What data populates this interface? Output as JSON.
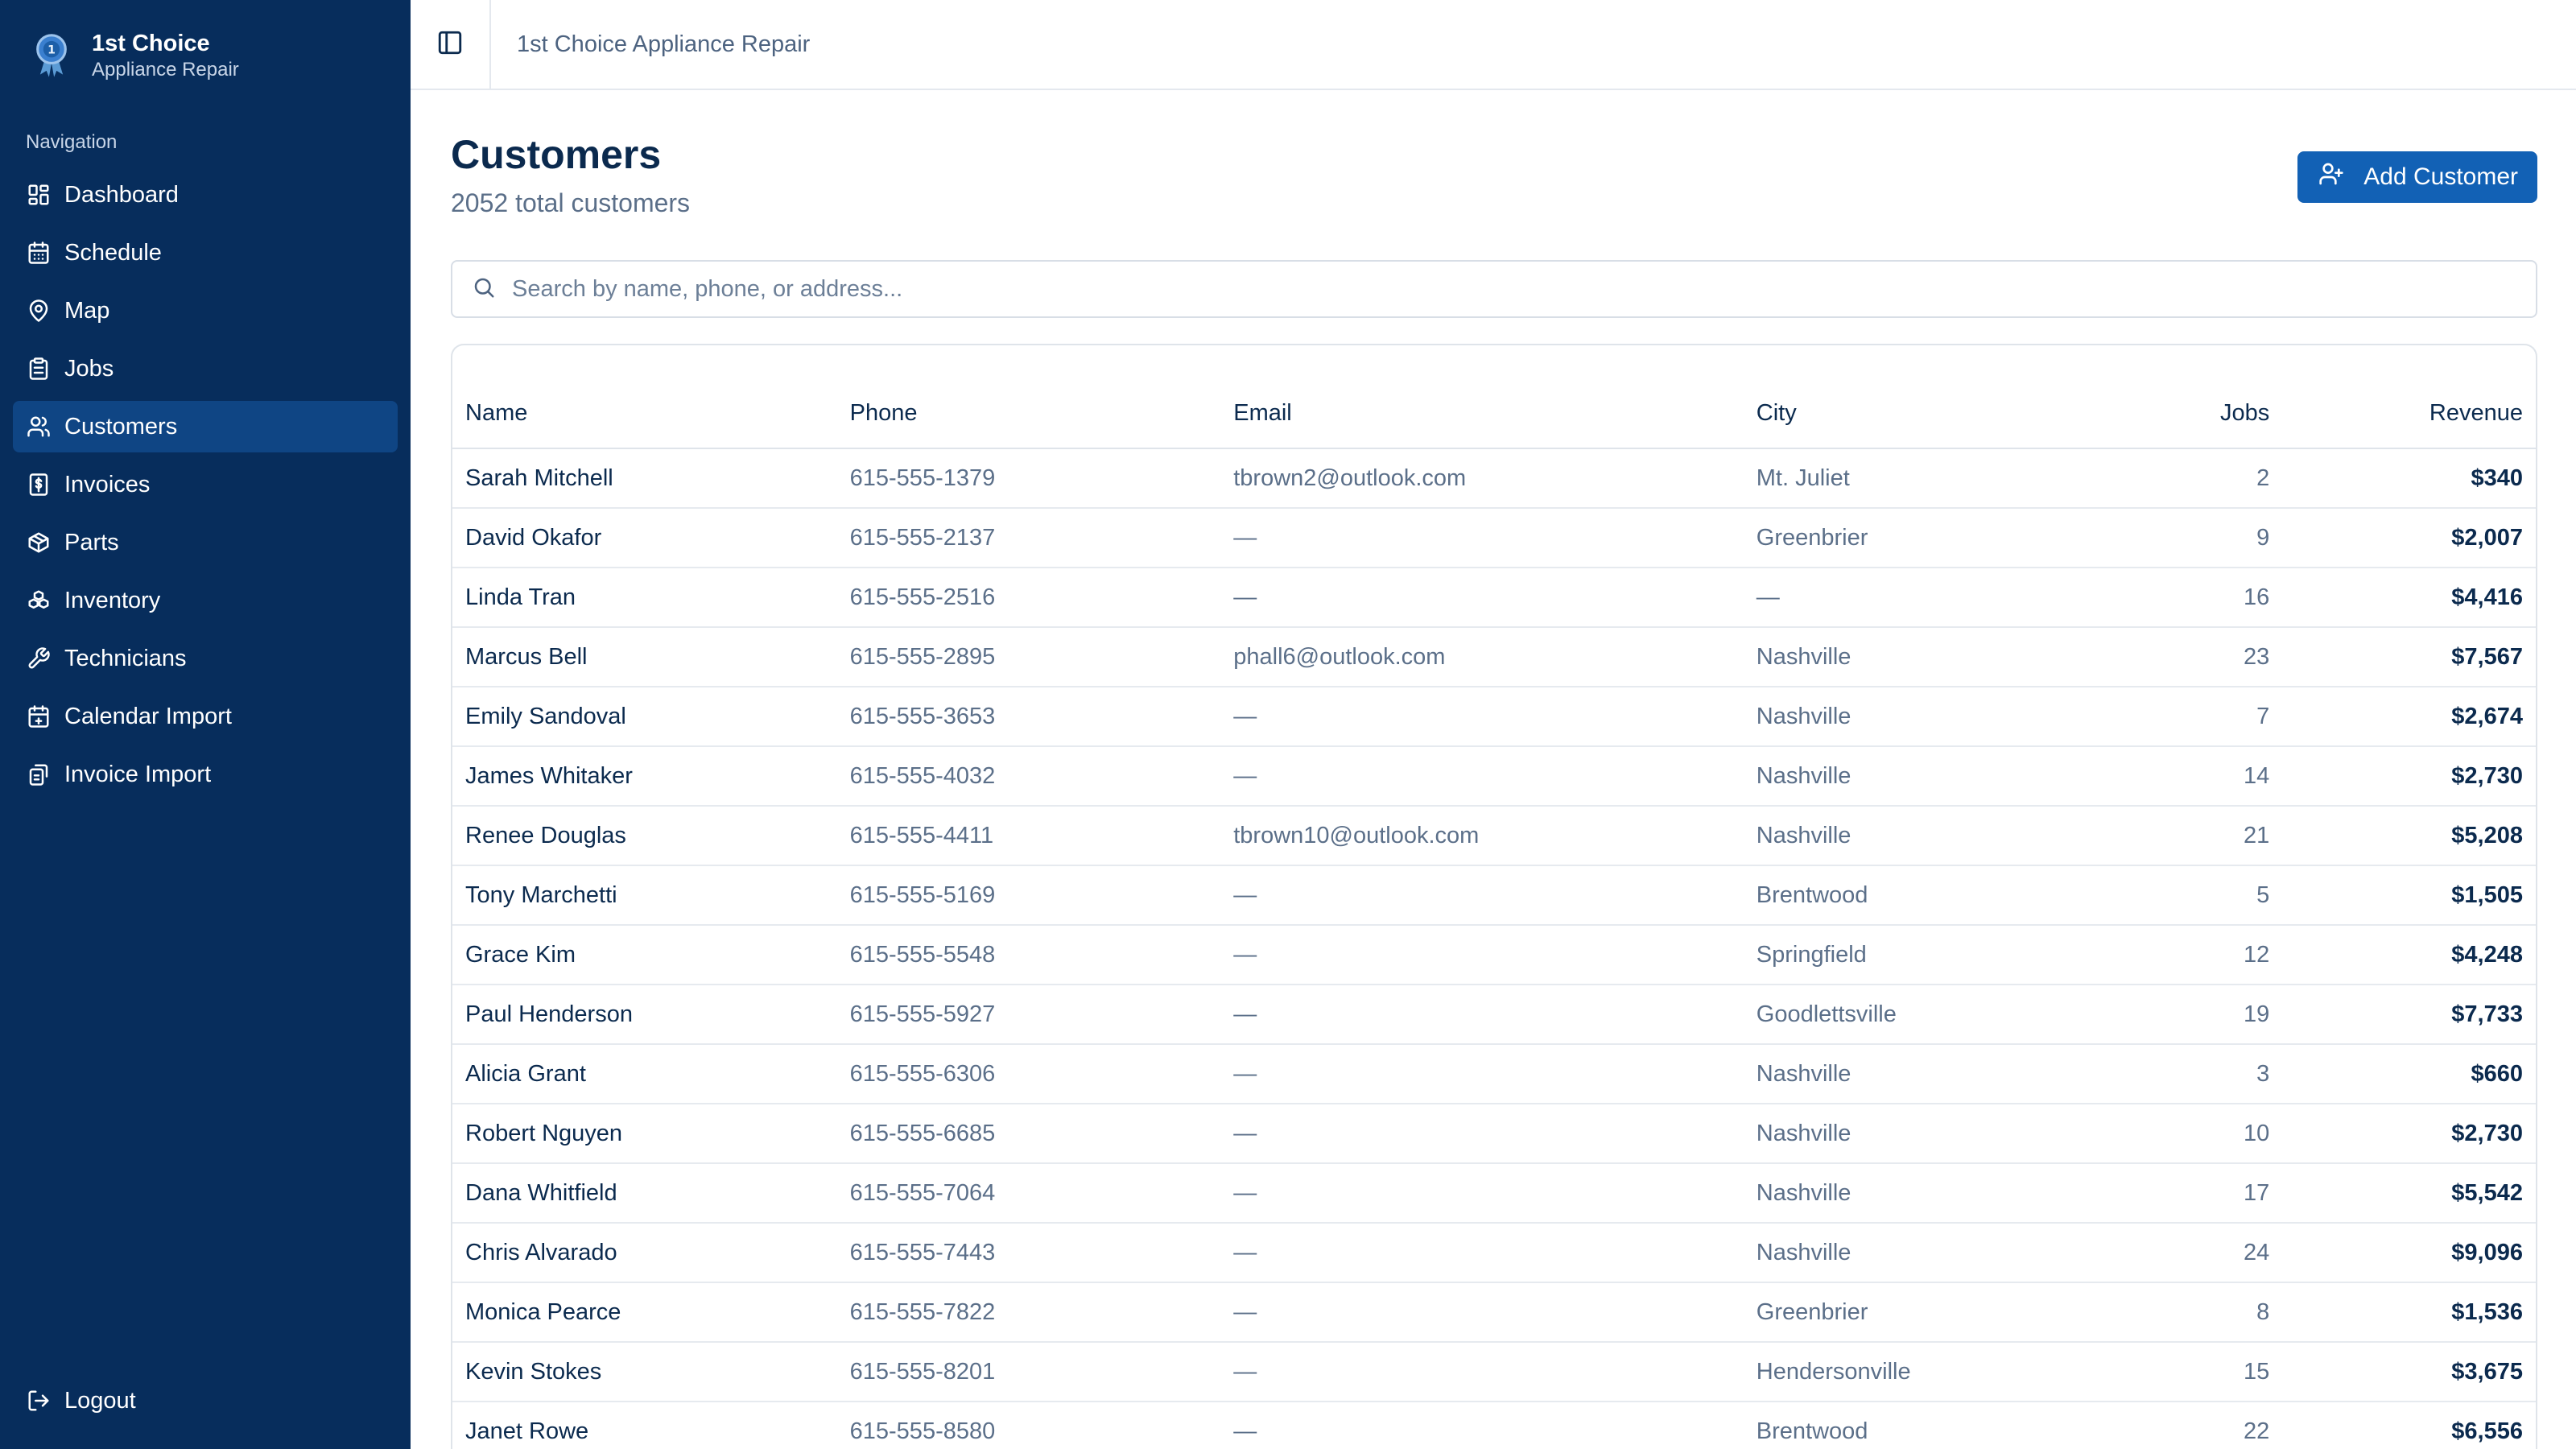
{
  "brand": {
    "name": "1st Choice",
    "subtitle": "Appliance Repair"
  },
  "sidebar": {
    "heading": "Navigation",
    "items": [
      {
        "label": "Dashboard",
        "icon": "dashboard-icon"
      },
      {
        "label": "Schedule",
        "icon": "calendar-icon"
      },
      {
        "label": "Map",
        "icon": "map-pin-icon"
      },
      {
        "label": "Jobs",
        "icon": "clipboard-icon"
      },
      {
        "label": "Customers",
        "icon": "users-icon",
        "active": true
      },
      {
        "label": "Invoices",
        "icon": "invoice-icon"
      },
      {
        "label": "Parts",
        "icon": "package-icon"
      },
      {
        "label": "Inventory",
        "icon": "boxes-icon"
      },
      {
        "label": "Technicians",
        "icon": "wrench-icon"
      },
      {
        "label": "Calendar Import",
        "icon": "calendar-plus-icon"
      },
      {
        "label": "Invoice Import",
        "icon": "import-icon"
      }
    ],
    "logout_label": "Logout"
  },
  "topbar": {
    "title": "1st Choice Appliance Repair"
  },
  "page": {
    "title": "Customers",
    "subtitle": "2052 total customers",
    "add_button_label": "Add Customer"
  },
  "search": {
    "placeholder": "Search by name, phone, or address...",
    "value": ""
  },
  "table": {
    "columns": [
      "Name",
      "Phone",
      "Email",
      "City",
      "Jobs",
      "Revenue"
    ],
    "rows": [
      {
        "name": "Sarah Mitchell",
        "phone": "615-555-1379",
        "email": "tbrown2@outlook.com",
        "city": "Mt. Juliet",
        "jobs": "2",
        "revenue": "$340"
      },
      {
        "name": "David Okafor",
        "phone": "615-555-2137",
        "email": "—",
        "city": "Greenbrier",
        "jobs": "9",
        "revenue": "$2,007"
      },
      {
        "name": "Linda Tran",
        "phone": "615-555-2516",
        "email": "—",
        "city": "—",
        "jobs": "16",
        "revenue": "$4,416"
      },
      {
        "name": "Marcus Bell",
        "phone": "615-555-2895",
        "email": "phall6@outlook.com",
        "city": "Nashville",
        "jobs": "23",
        "revenue": "$7,567"
      },
      {
        "name": "Emily Sandoval",
        "phone": "615-555-3653",
        "email": "—",
        "city": "Nashville",
        "jobs": "7",
        "revenue": "$2,674"
      },
      {
        "name": "James Whitaker",
        "phone": "615-555-4032",
        "email": "—",
        "city": "Nashville",
        "jobs": "14",
        "revenue": "$2,730"
      },
      {
        "name": "Renee Douglas",
        "phone": "615-555-4411",
        "email": "tbrown10@outlook.com",
        "city": "Nashville",
        "jobs": "21",
        "revenue": "$5,208"
      },
      {
        "name": "Tony Marchetti",
        "phone": "615-555-5169",
        "email": "—",
        "city": "Brentwood",
        "jobs": "5",
        "revenue": "$1,505"
      },
      {
        "name": "Grace Kim",
        "phone": "615-555-5548",
        "email": "—",
        "city": "Springfield",
        "jobs": "12",
        "revenue": "$4,248"
      },
      {
        "name": "Paul Henderson",
        "phone": "615-555-5927",
        "email": "—",
        "city": "Goodlettsville",
        "jobs": "19",
        "revenue": "$7,733"
      },
      {
        "name": "Alicia Grant",
        "phone": "615-555-6306",
        "email": "—",
        "city": "Nashville",
        "jobs": "3",
        "revenue": "$660"
      },
      {
        "name": "Robert Nguyen",
        "phone": "615-555-6685",
        "email": "—",
        "city": "Nashville",
        "jobs": "10",
        "revenue": "$2,730"
      },
      {
        "name": "Dana Whitfield",
        "phone": "615-555-7064",
        "email": "—",
        "city": "Nashville",
        "jobs": "17",
        "revenue": "$5,542"
      },
      {
        "name": "Chris Alvarado",
        "phone": "615-555-7443",
        "email": "—",
        "city": "Nashville",
        "jobs": "24",
        "revenue": "$9,096"
      },
      {
        "name": "Monica Pearce",
        "phone": "615-555-7822",
        "email": "—",
        "city": "Greenbrier",
        "jobs": "8",
        "revenue": "$1,536"
      },
      {
        "name": "Kevin Stokes",
        "phone": "615-555-8201",
        "email": "—",
        "city": "Hendersonville",
        "jobs": "15",
        "revenue": "$3,675"
      },
      {
        "name": "Janet Rowe",
        "phone": "615-555-8580",
        "email": "—",
        "city": "Brentwood",
        "jobs": "22",
        "revenue": "$6,556"
      }
    ]
  },
  "colors": {
    "sidebar_bg": "#072d5c",
    "sidebar_active": "#0f4584",
    "accent": "#1261b5",
    "text_primary": "#0b2a4e",
    "text_muted": "#5b6f89"
  }
}
